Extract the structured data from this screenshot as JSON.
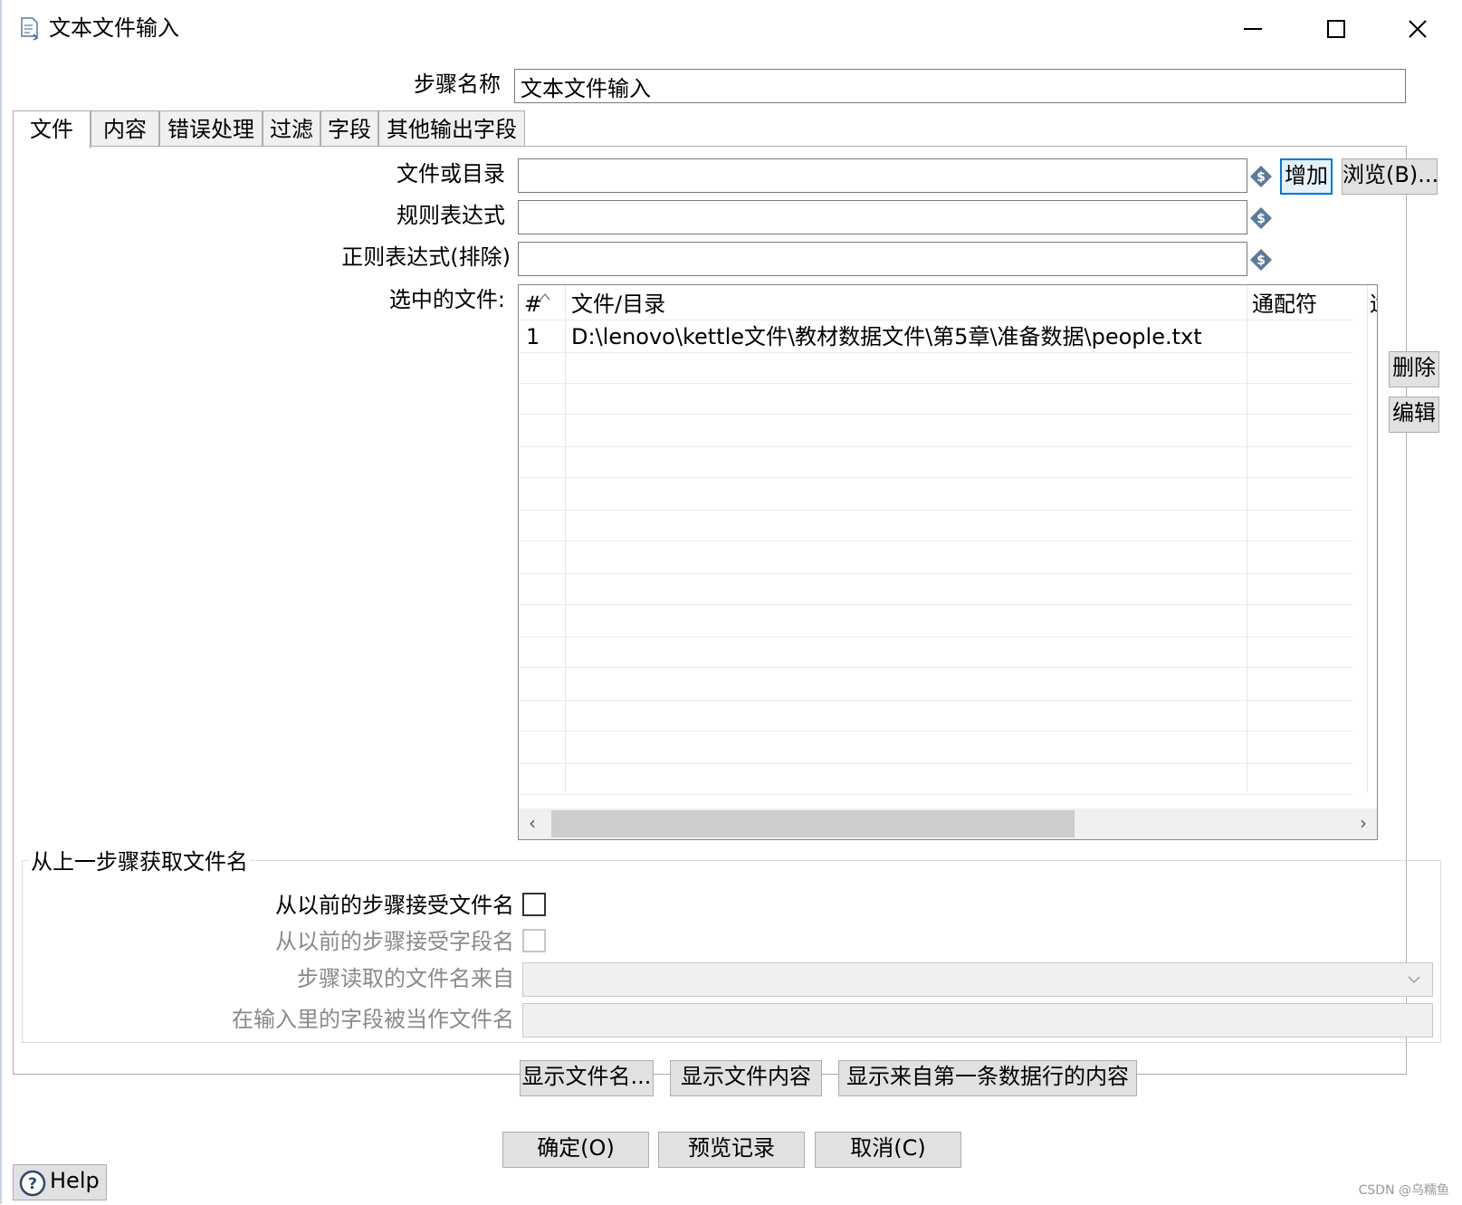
{
  "window": {
    "title": "文本文件输入",
    "controls": [
      "minimize-icon",
      "maximize-icon",
      "close-icon"
    ]
  },
  "step_name": {
    "label": "步骤名称",
    "value": "文本文件输入"
  },
  "tabs": [
    {
      "label": "文件",
      "active": true
    },
    {
      "label": "内容",
      "active": false
    },
    {
      "label": "错误处理",
      "active": false
    },
    {
      "label": "过滤",
      "active": false
    },
    {
      "label": "字段",
      "active": false
    },
    {
      "label": "其他输出字段",
      "active": false
    }
  ],
  "file_tab": {
    "file_or_dir_label": "文件或目录",
    "file_or_dir_value": "",
    "regex_label": "规则表达式",
    "regex_value": "",
    "regex_exclude_label": "正则表达式(排除)",
    "regex_exclude_value": "",
    "add_button": "增加",
    "browse_button": "浏览(B)...",
    "selected_files_label": "选中的文件:",
    "delete_button": "删除",
    "edit_button": "编辑",
    "table": {
      "columns": [
        "#",
        "文件/目录",
        "通配符",
        "适"
      ],
      "rows": [
        {
          "num": "1",
          "path": "D:\\lenovo\\kettle文件\\教材数据文件\\第5章\\准备数据\\people.txt",
          "wildcard": ""
        }
      ]
    }
  },
  "prev_step_group": {
    "title": "从上一步骤获取文件名",
    "accept_filenames_label": "从以前的步骤接受文件名",
    "accept_filenames_checked": false,
    "accept_fieldname_label": "从以前的步骤接受字段名",
    "accept_fieldname_checked": false,
    "step_source_label": "步骤读取的文件名来自",
    "step_source_value": "",
    "field_as_filename_label": "在输入里的字段被当作文件名",
    "field_as_filename_value": ""
  },
  "action_buttons": {
    "show_filenames": "显示文件名...",
    "show_content": "显示文件内容",
    "show_first_row": "显示来自第一条数据行的内容"
  },
  "footer": {
    "ok": "确定(O)",
    "preview": "预览记录",
    "cancel": "取消(C)",
    "help": "Help"
  },
  "watermark": "CSDN @乌糯鱼",
  "colors": {
    "focus_border": "#0078d7",
    "button_bg": "#e1e1e1",
    "variable_icon": "#5b7a9b"
  }
}
